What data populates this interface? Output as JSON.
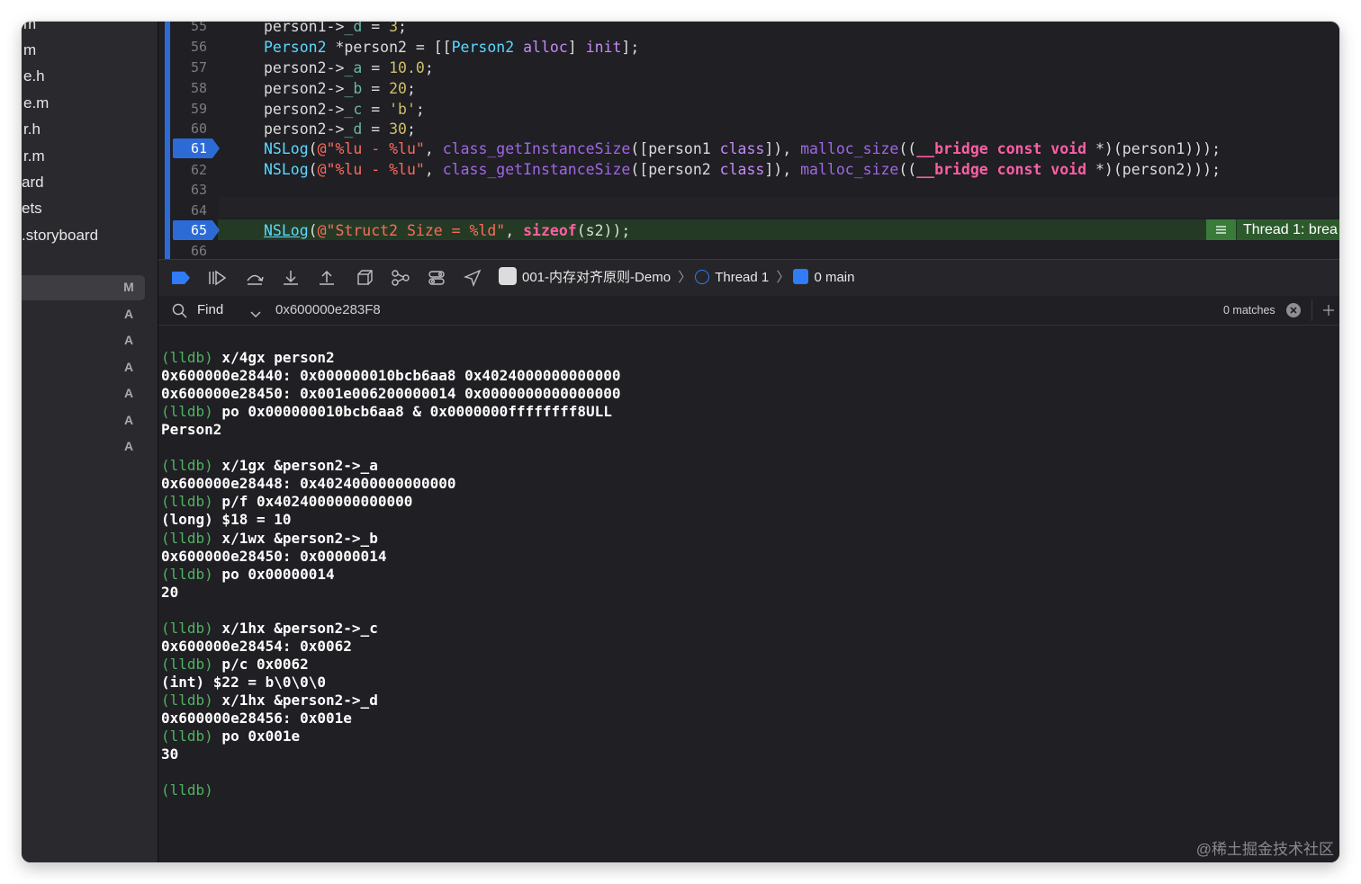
{
  "navigator": {
    "files": [
      "m",
      "m",
      "e.h",
      "e.m",
      "r.h",
      "r.m",
      "ard",
      "ets",
      ".storyboard"
    ],
    "statuses": [
      "M",
      "A",
      "A",
      "A",
      "A",
      "A",
      "A"
    ]
  },
  "editor": {
    "lines": [
      {
        "num": "55",
        "code": "person1->_d = 3;"
      },
      {
        "num": "56",
        "code": "Person2 *person2 = [[Person2 alloc] init];"
      },
      {
        "num": "57",
        "code": "person2->_a = 10.0;"
      },
      {
        "num": "58",
        "code": "person2->_b = 20;"
      },
      {
        "num": "59",
        "code": "person2->_c = 'b';"
      },
      {
        "num": "60",
        "code": "person2->_d = 30;"
      },
      {
        "num": "61",
        "code": "NSLog(@\"%lu - %lu\", class_getInstanceSize([person1 class]), malloc_size((__bridge const void *)(person1)));",
        "breakpoint": true
      },
      {
        "num": "62",
        "code": "NSLog(@\"%lu - %lu\", class_getInstanceSize([person2 class]), malloc_size((__bridge const void *)(person2)));"
      },
      {
        "num": "63",
        "code": ""
      },
      {
        "num": "64",
        "code": ""
      },
      {
        "num": "65",
        "code": "NSLog(@\"Struct2 Size = %ld\", sizeof(s2));",
        "breakpoint": true,
        "current": true
      },
      {
        "num": "66",
        "code": ""
      }
    ],
    "thread_badge": "Thread 1: brea"
  },
  "debug_bar": {
    "scheme": "001-内存对齐原则-Demo",
    "thread": "Thread 1",
    "frame": "0 main"
  },
  "find_bar": {
    "label": "Find",
    "query": "0x600000e283F8",
    "matches": "0 matches"
  },
  "console": {
    "lines": [
      {
        "prompt": "(lldb)",
        "text": " x/4gx person2"
      },
      {
        "text": "0x600000e28440: 0x000000010bcb6aa8 0x4024000000000000"
      },
      {
        "text": "0x600000e28450: 0x001e006200000014 0x0000000000000000"
      },
      {
        "prompt": "(lldb)",
        "text": " po 0x000000010bcb6aa8 & 0x0000000ffffffff8ULL"
      },
      {
        "text": "Person2"
      },
      {
        "text": ""
      },
      {
        "prompt": "(lldb)",
        "text": " x/1gx &person2->_a"
      },
      {
        "text": "0x600000e28448: 0x4024000000000000"
      },
      {
        "prompt": "(lldb)",
        "text": " p/f 0x4024000000000000"
      },
      {
        "text": "(long) $18 = 10"
      },
      {
        "prompt": "(lldb)",
        "text": " x/1wx &person2->_b"
      },
      {
        "text": "0x600000e28450: 0x00000014"
      },
      {
        "prompt": "(lldb)",
        "text": " po 0x00000014"
      },
      {
        "text": "20"
      },
      {
        "text": ""
      },
      {
        "prompt": "(lldb)",
        "text": " x/1hx &person2->_c"
      },
      {
        "text": "0x600000e28454: 0x0062"
      },
      {
        "prompt": "(lldb)",
        "text": " p/c 0x0062"
      },
      {
        "text": "(int) $22 = b\\0\\0\\0"
      },
      {
        "prompt": "(lldb)",
        "text": " x/1hx &person2->_d"
      },
      {
        "text": "0x600000e28456: 0x001e"
      },
      {
        "prompt": "(lldb)",
        "text": " po 0x001e"
      },
      {
        "text": "30"
      },
      {
        "text": ""
      },
      {
        "prompt": "(lldb)",
        "text": ""
      }
    ]
  },
  "watermark": "@稀土掘金技术社区",
  "colors": {
    "keyword": "#fc5fa3",
    "string": "#fc6a5d",
    "number": "#d0bf69",
    "method": "#a167e6",
    "prompt": "#4fb360",
    "breakpoint": "#2c6bd6"
  }
}
